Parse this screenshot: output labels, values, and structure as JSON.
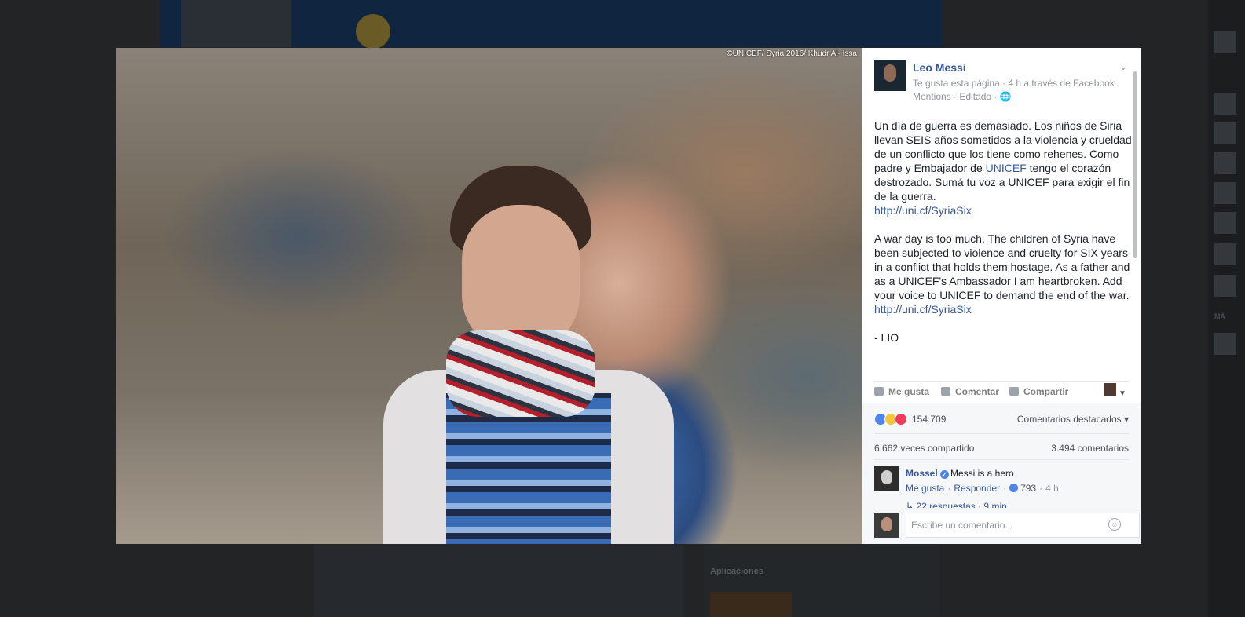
{
  "photo": {
    "credit": "©UNICEF/ Syria 2016/ Khudr Al- Issa"
  },
  "post": {
    "page_name": "Leo Messi",
    "meta_line1": "Te gusta esta página · 4 h a través de Facebook",
    "meta_line2": "Mentions · Editado · 🌐",
    "paragraph_es": "Un día de guerra es demasiado. Los niños de Siria llevan SEIS años sometidos a la violencia y crueldad de un conflicto que los tiene como rehenes. Como padre y Embajador de ",
    "unicef_link": "UNICEF",
    "paragraph_es_2": " tengo el corazón destrozado. Sumá tu voz a UNICEF para exigir el fin de la guerra.",
    "link_es": "http://uni.cf/SyriaSix",
    "paragraph_en": "A war day is too much. The children of Syria have been subjected to violence and cruelty for SIX years in a conflict that holds them hostage. As a father and as a UNICEF's Ambassador I am heartbroken. Add your voice to UNICEF to demand the end of the war. ",
    "link_en": "http://uni.cf/SyriaSix",
    "signature": "- LIO"
  },
  "actions": {
    "like": "Me gusta",
    "comment": "Comentar",
    "share": "Compartir"
  },
  "stats": {
    "reactions": "154.709",
    "top_comments": "Comentarios destacados ▾",
    "shares": "6.662 veces compartido",
    "comments": "3.494 comentarios"
  },
  "comment": {
    "author": "Mossel",
    "text": "Messi is a hero",
    "like": "Me gusta",
    "reply": "Responder",
    "likes": "793",
    "time": "4 h",
    "replies": "↳ 22 respuestas · 9 min"
  },
  "composer": {
    "placeholder": "Escribe un comentario..."
  },
  "background": {
    "apps_label": "Aplicaciones",
    "rail_label": "MÁ"
  },
  "colors": {
    "link": "#365899",
    "meta": "#90949c",
    "overlay": "#222426"
  }
}
